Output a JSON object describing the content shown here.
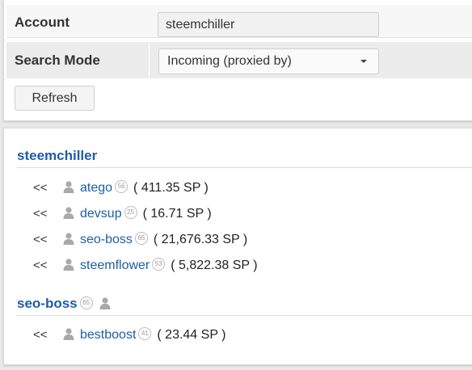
{
  "form": {
    "account_label": "Account",
    "account_value": "steemchiller",
    "mode_label": "Search Mode",
    "mode_selected": "Incoming (proxied by)",
    "refresh_label": "Refresh"
  },
  "groups": [
    {
      "name": "steemchiller",
      "reputation": null,
      "entries": [
        {
          "arrow": "<<",
          "name": "atego",
          "reputation": "56",
          "sp": "( 411.35 SP )"
        },
        {
          "arrow": "<<",
          "name": "devsup",
          "reputation": "25",
          "sp": "( 16.71 SP )"
        },
        {
          "arrow": "<<",
          "name": "seo-boss",
          "reputation": "65",
          "sp": "( 21,676.33 SP )"
        },
        {
          "arrow": "<<",
          "name": "steemflower",
          "reputation": "53",
          "sp": "( 5,822.38 SP )"
        }
      ]
    },
    {
      "name": "seo-boss",
      "reputation": "65",
      "entries": [
        {
          "arrow": "<<",
          "name": "bestboost",
          "reputation": "41",
          "sp": "( 23.44 SP )"
        }
      ]
    }
  ],
  "colors": {
    "link": "#1d5da8",
    "panel_bg": "#ffffff",
    "page_bg": "#e9e9e9"
  },
  "icons": {
    "user": "user-icon",
    "dropdown": "chevron-down-icon"
  }
}
